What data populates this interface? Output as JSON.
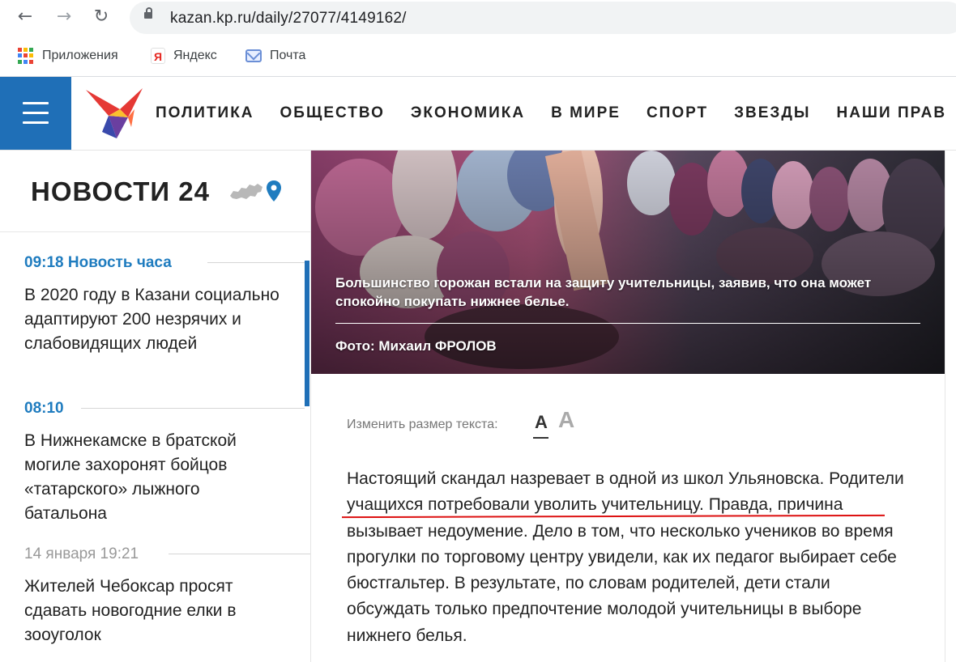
{
  "browser": {
    "url": "kazan.kp.ru/daily/27077/4149162/",
    "bookmarks": [
      {
        "label": "Приложения",
        "icon": "apps-grid-icon"
      },
      {
        "label": "Яндекс",
        "icon": "yandex-icon"
      },
      {
        "label": "Почта",
        "icon": "mail-icon"
      }
    ]
  },
  "site": {
    "nav": [
      "ПОЛИТИКА",
      "ОБЩЕСТВО",
      "ЭКОНОМИКА",
      "В МИРЕ",
      "СПОРТ",
      "ЗВЕЗДЫ",
      "НАШИ ПРАВ"
    ],
    "brand_color": "#1f6fb7"
  },
  "sidebar": {
    "title": "НОВОСТИ 24",
    "items": [
      {
        "time": "09:18 Новость часа",
        "text": "В 2020 году в Казани социально адаптируют 200 незрячих и слабовидящих людей"
      },
      {
        "time": "08:10",
        "text": "В Нижнекамске в братской могиле захоронят бойцов «татарского» лыжного батальона"
      },
      {
        "time": "14 января 19:21",
        "text": "Жителей Чебоксар просят сдавать новогодние елки в зооуголок"
      }
    ]
  },
  "article": {
    "caption": "Большинство горожан встали на защиту учительницы, заявив, что она может спокойно покупать нижнее белье.",
    "photo_credit": "Фото: Михаил ФРОЛОВ",
    "font_size_label": "Изменить размер текста:",
    "font_small": "A",
    "font_large": "A",
    "body": "Настоящий скандал назревает в одной из школ Ульяновска. Родители учащихся потребовали уволить учительницу. Правда, причина вызывает недоумение. Дело в том, что несколько учеников во время прогулки по торговому центру увидели, как их педагог выбирает себе бюстгальтер. В результате, по словам родителей, дети стали обсуждать только предпочтение молодой учительницы в выборе нижнего белья."
  }
}
